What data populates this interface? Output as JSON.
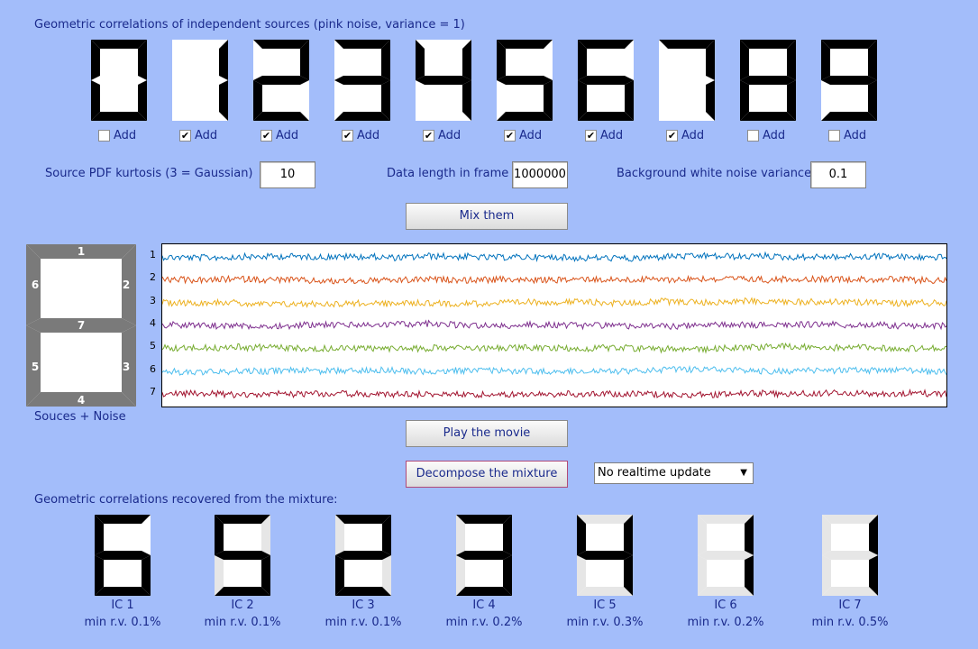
{
  "sources_title": "Geometric correlations of independent sources (pink noise, variance = 1)",
  "digits": [
    {
      "digit": "0",
      "checked": false
    },
    {
      "digit": "1",
      "checked": true
    },
    {
      "digit": "2",
      "checked": true
    },
    {
      "digit": "3",
      "checked": true
    },
    {
      "digit": "4",
      "checked": true
    },
    {
      "digit": "5",
      "checked": true
    },
    {
      "digit": "6",
      "checked": true
    },
    {
      "digit": "7",
      "checked": true
    },
    {
      "digit": "8",
      "checked": false
    },
    {
      "digit": "9",
      "checked": false
    }
  ],
  "add_label": "Add",
  "kurtosis": {
    "label": "Source PDF kurtosis (3 = Gaussian)",
    "value": "10"
  },
  "data_length": {
    "label": "Data length in frame",
    "value": "1000000"
  },
  "noise_variance": {
    "label": "Background white noise variance",
    "value": "0.1"
  },
  "mix_button": "Mix them",
  "segment_diagram": {
    "caption": "Souces + Noise",
    "segments": [
      "1",
      "2",
      "3",
      "4",
      "5",
      "6",
      "7"
    ]
  },
  "traces": {
    "labels": [
      "1",
      "2",
      "3",
      "4",
      "5",
      "6",
      "7"
    ],
    "colors": [
      "#0072bd",
      "#d95319",
      "#edb120",
      "#7e2f8e",
      "#77ac30",
      "#4dbeee",
      "#a2142f"
    ]
  },
  "play_button": "Play the movie",
  "decompose_button": "Decompose the mixture",
  "update_select": "No realtime update",
  "recovered_title": "Geometric correlations recovered from the mixture:",
  "components": [
    {
      "name": "IC 1",
      "min_rv": "min r.v. 0.1%"
    },
    {
      "name": "IC 2",
      "min_rv": "min r.v. 0.1%"
    },
    {
      "name": "IC 3",
      "min_rv": "min r.v. 0.1%"
    },
    {
      "name": "IC 4",
      "min_rv": "min r.v. 0.2%"
    },
    {
      "name": "IC 5",
      "min_rv": "min r.v. 0.3%"
    },
    {
      "name": "IC 6",
      "min_rv": "min r.v. 0.2%"
    },
    {
      "name": "IC 7",
      "min_rv": "min r.v. 0.5%"
    }
  ]
}
